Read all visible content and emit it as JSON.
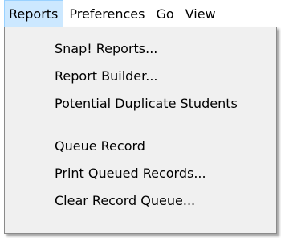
{
  "menubar": {
    "items": [
      {
        "label": "Reports"
      },
      {
        "label": "Preferences"
      },
      {
        "label": "Go"
      },
      {
        "label": "View"
      }
    ]
  },
  "reports_menu": {
    "group1": [
      {
        "label": "Snap! Reports..."
      },
      {
        "label": "Report Builder..."
      },
      {
        "label": "Potential Duplicate Students"
      }
    ],
    "group2": [
      {
        "label": "Queue Record"
      },
      {
        "label": "Print Queued Records..."
      },
      {
        "label": "Clear Record Queue..."
      }
    ]
  }
}
